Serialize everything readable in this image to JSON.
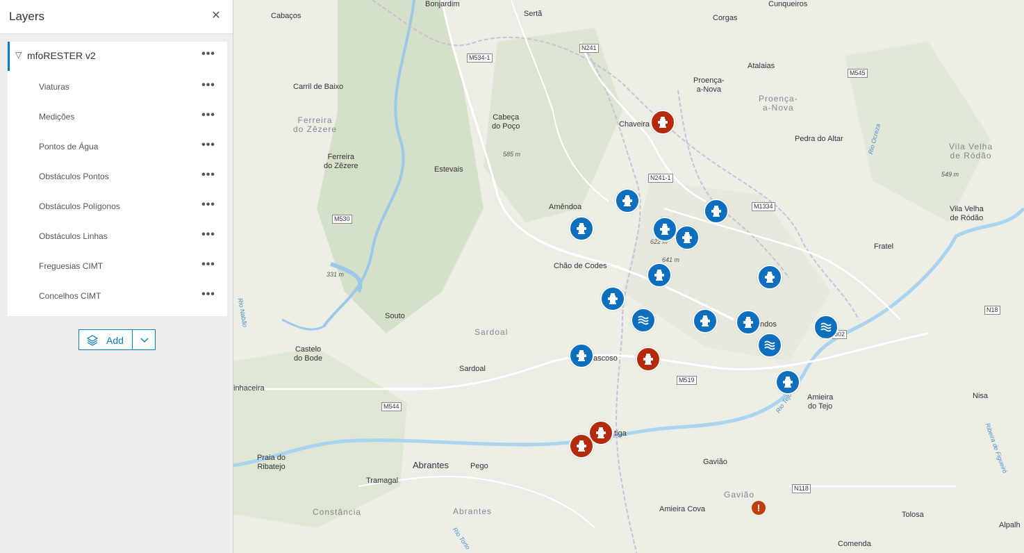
{
  "panel": {
    "title": "Layers",
    "close_icon": "close-icon",
    "group": {
      "label": "mfoRESTER v2",
      "actions": "•••"
    },
    "layers": [
      {
        "label": "Viaturas",
        "actions": "•••"
      },
      {
        "label": "Medições",
        "actions": "•••"
      },
      {
        "label": "Pontos de Água",
        "actions": "•••"
      },
      {
        "label": "Obstáculos Pontos",
        "actions": "•••"
      },
      {
        "label": "Obstáculos Polígonos",
        "actions": "•••"
      },
      {
        "label": "Obstáculos Linhas",
        "actions": "•••"
      },
      {
        "label": "Freguesias CIMT",
        "actions": "•••"
      },
      {
        "label": "Concelhos CIMT",
        "actions": "•••"
      }
    ],
    "add_label": "Add",
    "accent_color": "#007ac2"
  },
  "map": {
    "places": [
      "Bonjardim",
      "Sertã",
      "Cunqueiros",
      "Cabaços",
      "Corgas",
      "Atalaias",
      "Proença-\na-Nova",
      "Carril de Baixo",
      "Cabeça\ndo Poço",
      "Chaveira",
      "Pedra do Altar",
      "Ferreira\ndo Zêzere",
      "Estevais",
      "Amêndoa",
      "Vila Velha\nde Ródão",
      "Chão de Codes",
      "Fratel",
      "Souto",
      "Castelo\ndo Bode",
      "Sardoal",
      "ascoso",
      "Amieira\ndo Tejo",
      "Nisa",
      "inhaceira",
      "Praia do\nRibatejo",
      "Abrantes",
      "Pego",
      "Tramagal",
      "Gavião",
      "Amieira Cova",
      "Tolosa",
      "Alpalh",
      "Comenda",
      "ndos",
      "tiga"
    ],
    "regions": [
      "Ferreira\ndo Zêzere",
      "Proença-\na-Nova",
      "Vila Velha\nde Ródão",
      "Sardoal",
      "Constância",
      "Abrantes",
      "Gavião"
    ],
    "elevations": [
      "585 m",
      "549 m",
      "331 m",
      "622 m",
      "641 m"
    ],
    "roads": [
      "M534-1",
      "N241",
      "M545",
      "N241-1",
      "M1334",
      "M530",
      "N18",
      "M519",
      "M544",
      "N118",
      "802"
    ],
    "rivers": [
      "Rio Ocreza",
      "Rio Nabão",
      "Rio Tejo",
      "Ribeira de Figueiró",
      "Rio Torto"
    ],
    "marker_colors": {
      "hydrant": "#0f6fbf",
      "water": "#0f6fbf",
      "obstacle": "#b5290c",
      "alert": "#c13c11"
    }
  }
}
